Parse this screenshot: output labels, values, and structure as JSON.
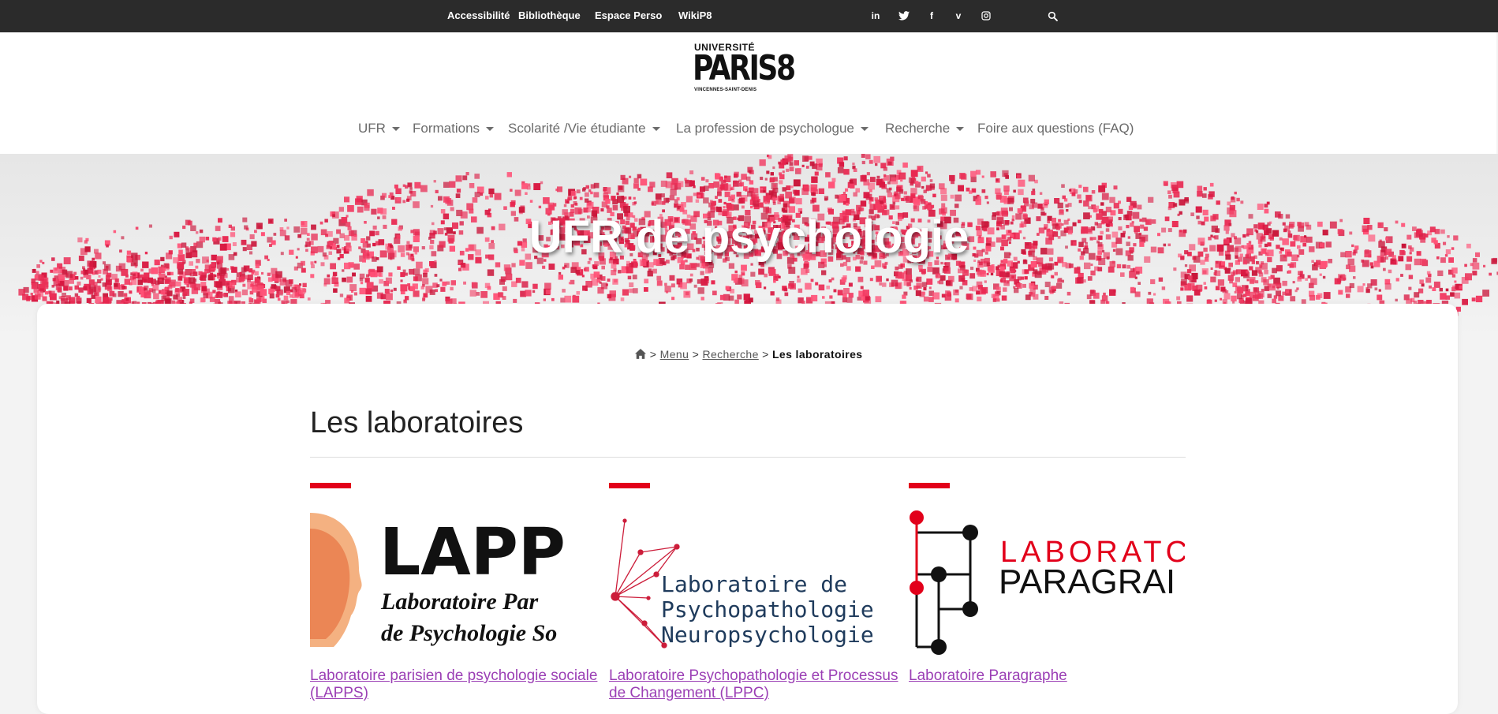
{
  "topbar": {
    "links": [
      "Accessibilité",
      "Bibliothèque",
      "Espace Perso",
      "WikiP8"
    ],
    "social": [
      "linkedin-icon",
      "twitter-icon",
      "facebook-icon",
      "vimeo-icon",
      "instagram-icon"
    ],
    "search_icon": "search-icon"
  },
  "logo": {
    "line1": "UNIVERSITÉ",
    "line2": "PARIS8",
    "line3": "VINCENNES-SAINT-DENIS"
  },
  "nav": [
    "UFR",
    "Formations",
    "Scolarité /Vie étudiante",
    "La profession de psychologue",
    "Recherche",
    "Foire aux questions (FAQ)"
  ],
  "hero": {
    "title": "UFR de psychologie"
  },
  "breadcrumb": {
    "sep": ">",
    "items": [
      "Menu",
      "Recherche"
    ],
    "current": "Les laboratoires"
  },
  "page": {
    "title": "Les laboratoires"
  },
  "labs": [
    {
      "logo_text": [
        "LAPP",
        "Laboratoire Par",
        "de Psychologie So"
      ],
      "name": "Laboratoire parisien de psychologie sociale (LAPPS)"
    },
    {
      "logo_text": [
        "Laboratoire de",
        "Psychopathologie",
        "Neuropsychologie"
      ],
      "name": "Laboratoire Psychopathologie et Processus de Changement (LPPC)"
    },
    {
      "logo_text": [
        "LABORATC",
        "PARAGRAI"
      ],
      "name": "Laboratoire Paragraphe"
    }
  ],
  "colors": {
    "accent_red": "#e2001a",
    "link_purple": "#9b3fb5",
    "topbar": "#2b2b2b"
  }
}
